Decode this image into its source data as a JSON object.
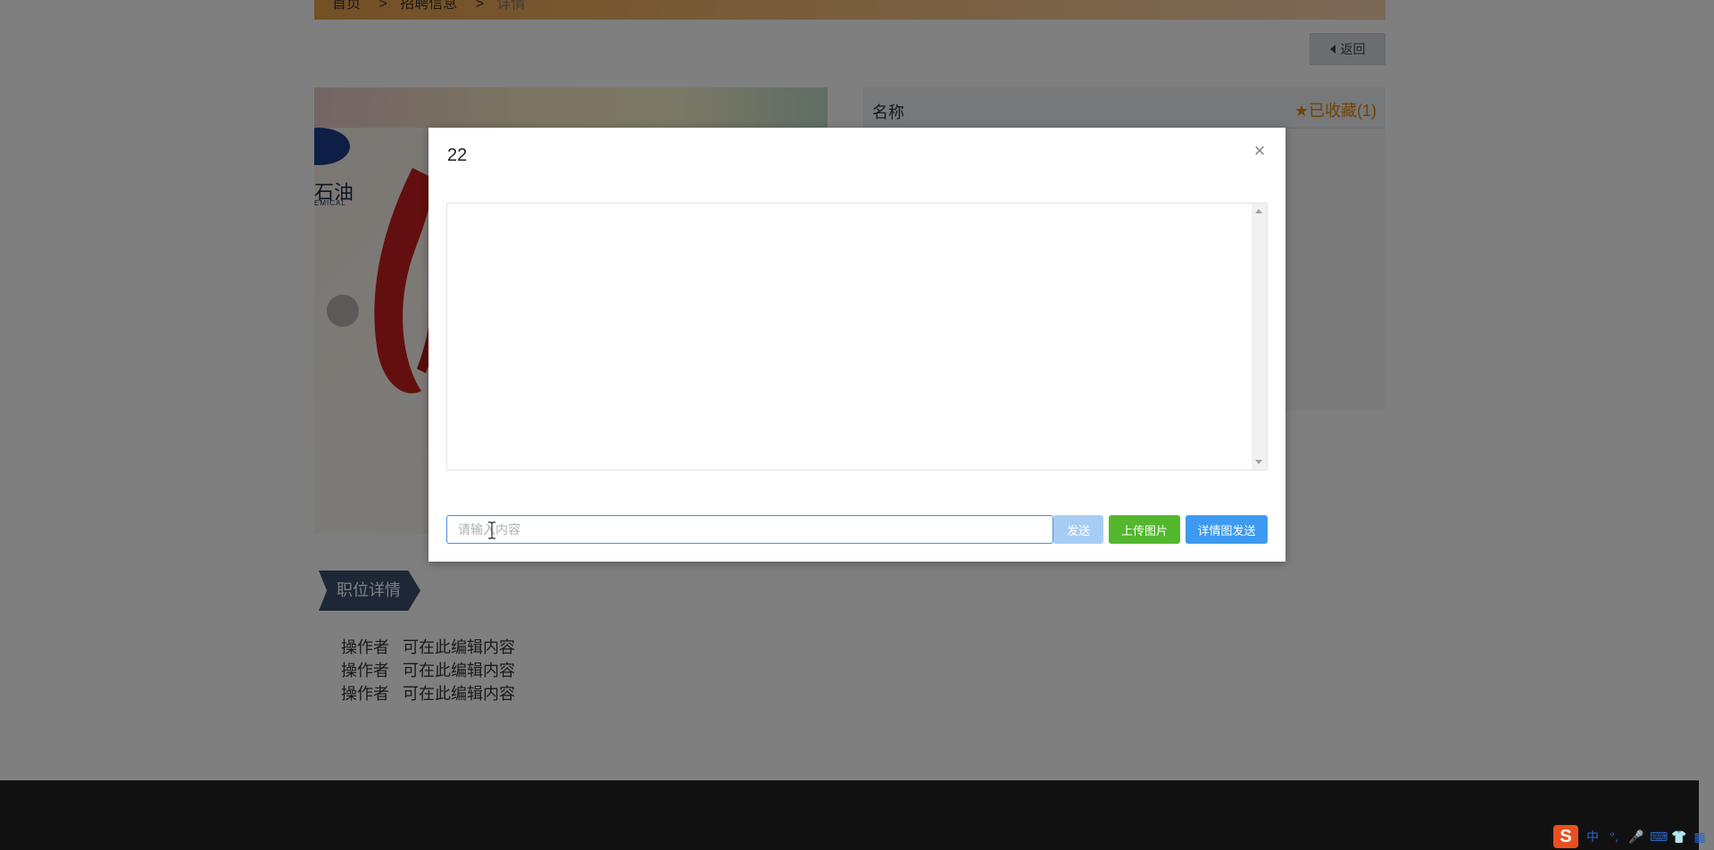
{
  "breadcrumb": {
    "home": "首页",
    "sep1": ">",
    "recruit": "招聘信息",
    "sep2": ">",
    "current": "详情"
  },
  "back_label": "返回",
  "info": {
    "name_label": "名称",
    "fav_label": "已收藏(1)"
  },
  "image": {
    "logo_text": "石油",
    "logo_sub": "EMICAL"
  },
  "section_tag": "职位详情",
  "description": [
    {
      "who": "操作者",
      "text": "可在此编辑内容"
    },
    {
      "who": "操作者",
      "text": "可在此编辑内容"
    },
    {
      "who": "操作者",
      "text": "可在此编辑内容"
    }
  ],
  "modal": {
    "title": "22",
    "close_glyph": "×",
    "input_placeholder": "请输入内容",
    "buttons": {
      "send": "发送",
      "upload": "上传图片",
      "detail_send": "详情图发送"
    }
  },
  "ime": {
    "logo": "S",
    "lang": "中",
    "punct": "°,",
    "mic": "🎤",
    "kbd": "⌨",
    "skin": "👕",
    "grid": "▦"
  },
  "colors": {
    "accent_blue": "#3d9af0",
    "upload_green": "#53b82d",
    "send_disabled": "#a7cdf5",
    "fav_orange": "#e2880b"
  }
}
